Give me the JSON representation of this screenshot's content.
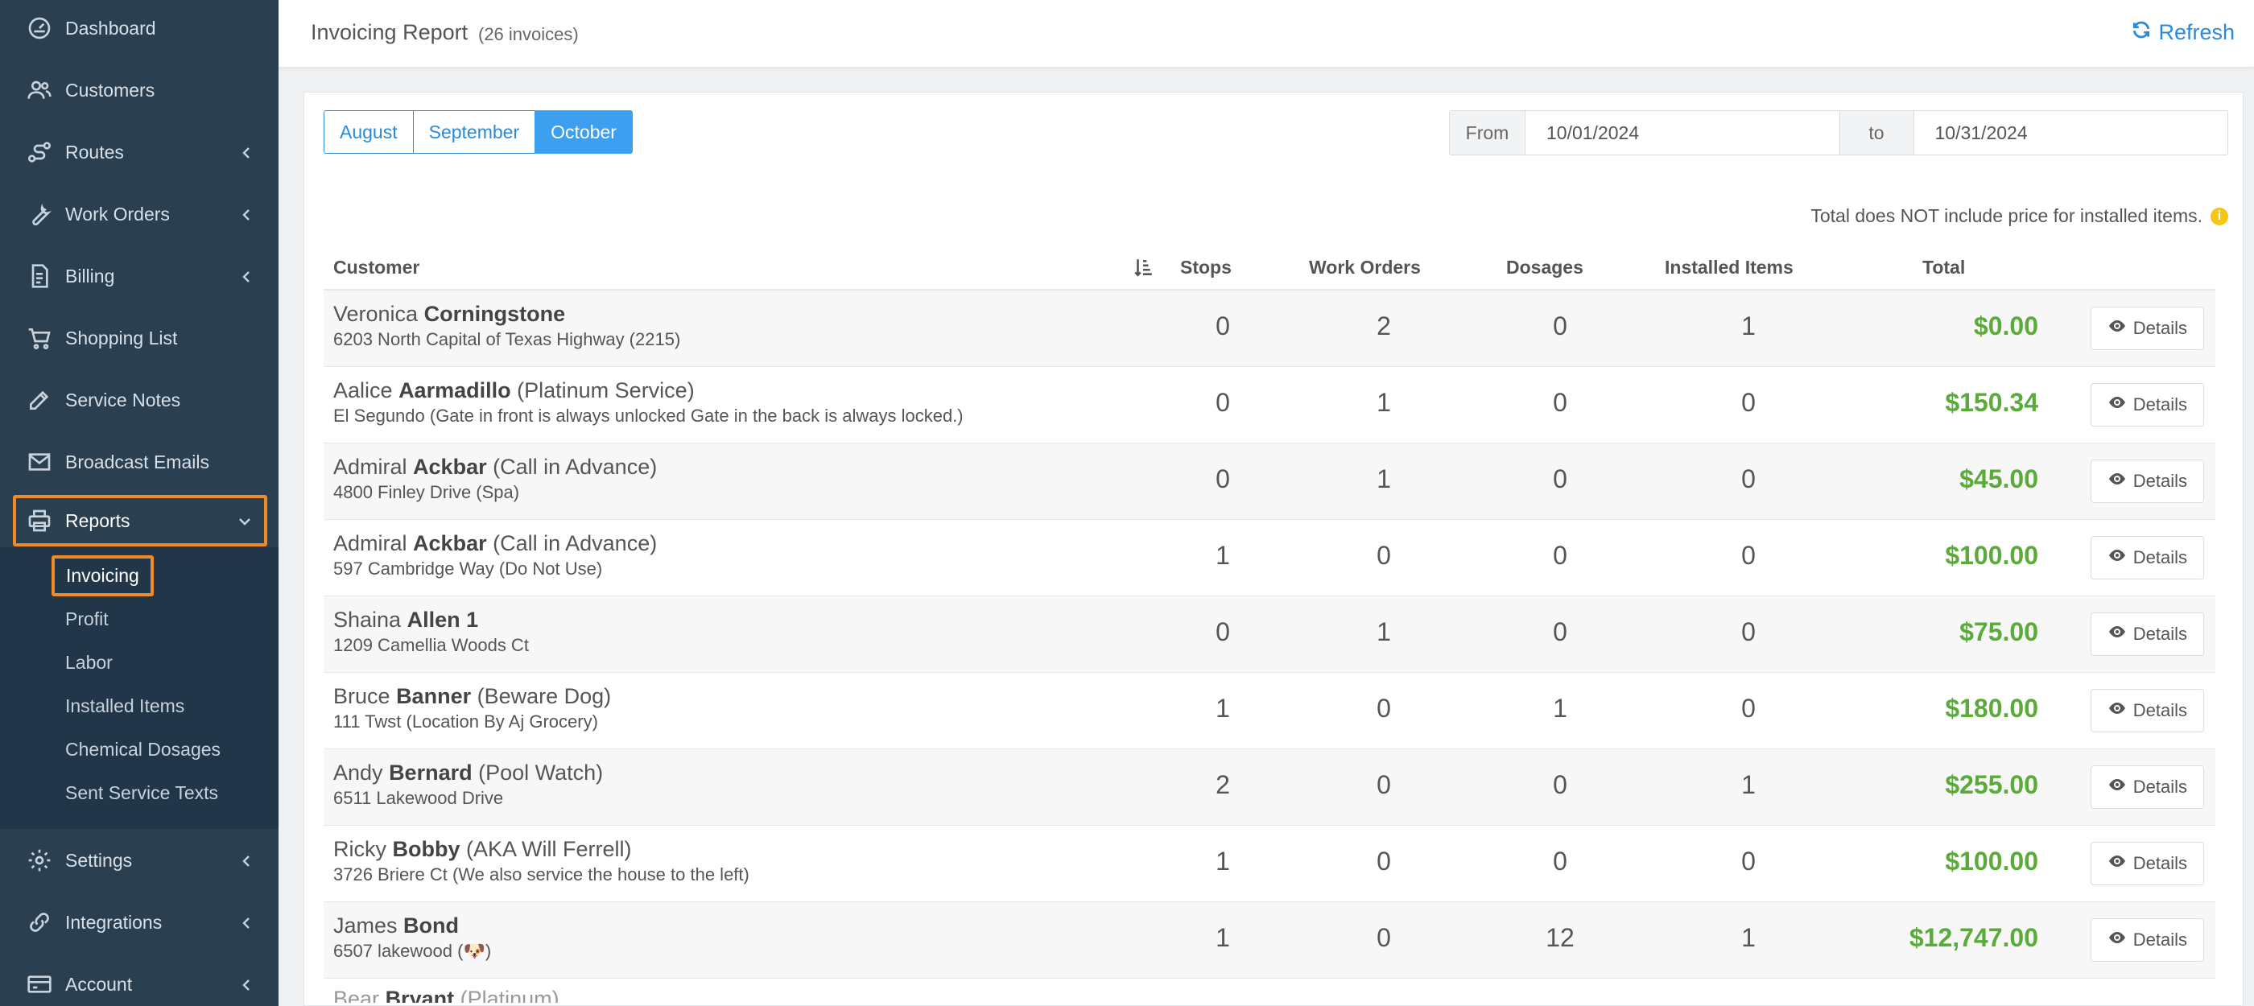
{
  "sidebar": {
    "items": [
      {
        "label": "Dashboard",
        "icon": "dashboard-icon"
      },
      {
        "label": "Customers",
        "icon": "users-icon"
      },
      {
        "label": "Routes",
        "icon": "route-icon"
      },
      {
        "label": "Work Orders",
        "icon": "wrench-icon"
      },
      {
        "label": "Billing",
        "icon": "invoice-icon"
      },
      {
        "label": "Shopping List",
        "icon": "cart-icon"
      },
      {
        "label": "Service Notes",
        "icon": "edit-icon"
      },
      {
        "label": "Broadcast Emails",
        "icon": "envelope-icon"
      },
      {
        "label": "Reports",
        "icon": "printer-icon"
      },
      {
        "label": "Settings",
        "icon": "gear-icon"
      },
      {
        "label": "Integrations",
        "icon": "link-icon"
      },
      {
        "label": "Account",
        "icon": "card-icon"
      }
    ],
    "reports_sub": [
      "Invoicing",
      "Profit",
      "Labor",
      "Installed Items",
      "Chemical Dosages",
      "Sent Service Texts"
    ]
  },
  "header": {
    "title": "Invoicing Report",
    "count": "(26 invoices)",
    "refresh_label": "Refresh"
  },
  "months": [
    "August",
    "September",
    "October"
  ],
  "selected_month": "October",
  "date_range": {
    "from_label": "From",
    "from_value": "10/01/2024",
    "to_label": "to",
    "to_value": "10/31/2024"
  },
  "note": "Total does NOT include price for installed items.",
  "table": {
    "headers": {
      "customer": "Customer",
      "stops": "Stops",
      "work_orders": "Work Orders",
      "dosages": "Dosages",
      "installed": "Installed Items",
      "total": "Total"
    },
    "details_label": "Details",
    "rows": [
      {
        "first": "Veronica",
        "last": "Corningstone",
        "note": "",
        "address": "6203 North Capital of Texas Highway (2215)",
        "stops": "0",
        "work_orders": "2",
        "dosages": "0",
        "installed": "1",
        "total": "$0.00"
      },
      {
        "first": "Aalice",
        "last": "Aarmadillo",
        "note": "(Platinum Service)",
        "address": "El Segundo (Gate in front is always unlocked Gate in the back is always locked.)",
        "stops": "0",
        "work_orders": "1",
        "dosages": "0",
        "installed": "0",
        "total": "$150.34"
      },
      {
        "first": "Admiral",
        "last": "Ackbar",
        "note": "(Call in Advance)",
        "address": "4800 Finley Drive (Spa)",
        "stops": "0",
        "work_orders": "1",
        "dosages": "0",
        "installed": "0",
        "total": "$45.00"
      },
      {
        "first": "Admiral",
        "last": "Ackbar",
        "note": "(Call in Advance)",
        "address": "597 Cambridge Way (Do Not Use)",
        "stops": "1",
        "work_orders": "0",
        "dosages": "0",
        "installed": "0",
        "total": "$100.00"
      },
      {
        "first": "Shaina",
        "last": "Allen 1",
        "note": "",
        "address": "1209 Camellia Woods Ct",
        "stops": "0",
        "work_orders": "1",
        "dosages": "0",
        "installed": "0",
        "total": "$75.00"
      },
      {
        "first": "Bruce",
        "last": "Banner",
        "note": "(Beware Dog)",
        "address": "111 Twst (Location By Aj Grocery)",
        "stops": "1",
        "work_orders": "0",
        "dosages": "1",
        "installed": "0",
        "total": "$180.00"
      },
      {
        "first": "Andy",
        "last": "Bernard",
        "note": "(Pool Watch)",
        "address": "6511 Lakewood Drive",
        "stops": "2",
        "work_orders": "0",
        "dosages": "0",
        "installed": "1",
        "total": "$255.00"
      },
      {
        "first": "Ricky",
        "last": "Bobby",
        "note": "(AKA Will Ferrell)",
        "address": "3726 Briere Ct (We also service the house to the left)",
        "stops": "1",
        "work_orders": "0",
        "dosages": "0",
        "installed": "0",
        "total": "$100.00"
      },
      {
        "first": "James",
        "last": "Bond",
        "note": "",
        "address": "6507 lakewood (🐶)",
        "stops": "1",
        "work_orders": "0",
        "dosages": "12",
        "installed": "1",
        "total": "$12,747.00"
      }
    ],
    "peek_row": {
      "first": "Bear",
      "last": "Bryant",
      "note": "(Platinum)"
    }
  },
  "colors": {
    "sidebar": "#2a3f50",
    "accent": "#2b8ad8",
    "highlight": "#f08a24",
    "money": "#5aab3a"
  }
}
